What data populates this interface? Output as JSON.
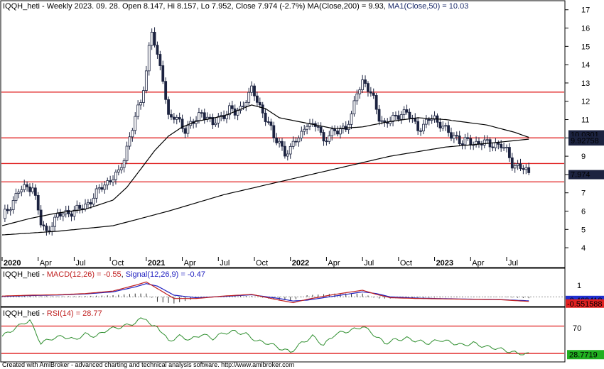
{
  "panels": {
    "price": {
      "header_symbol": "IQQH_heti",
      "header_info": " - Weekly 2023. 09. 28. Open 8.147, Hi 8.157, Lo 7.952, Close 7.974 (-2.7%)",
      "header_ma200": "MA(Close,200) = 9.93",
      "header_ma50": "MA1(Close,50) = 10.03",
      "badges": [
        "10.0301",
        "9.92758",
        "7.974"
      ]
    },
    "macd": {
      "header_symbol": "IQQH_heti - ",
      "header_macd": "MACD(12,26) = -0.55",
      "header_signal": "Signal(12,26,9) = -0.47",
      "badges": [
        "-0.469418",
        "-0.551588"
      ],
      "axis_label": "1"
    },
    "rsi": {
      "header_symbol": "IQQH_heti - ",
      "header_rsi": "RSI(14) = 28.77",
      "badges": [
        "28.7719"
      ],
      "axis_label": "70"
    }
  },
  "footer": "Created with AmiBroker - advanced charting and technical analysis software. http://www.amibroker.com",
  "colors": {
    "up": "#ffffff",
    "down": "#1c2340",
    "hline": "#e02020",
    "ma": "#000000",
    "macd": "#2020c0",
    "signal": "#c02020",
    "rsi": "#2f8f2f",
    "badge_dark": "#1c2340",
    "badge_red": "#e02020",
    "badge_blue": "#2030d0",
    "badge_green": "#20b020"
  },
  "chart_data": [
    {
      "type": "candlestick",
      "title": "IQQH_heti - Weekly",
      "ylim": [
        3.5,
        17.3
      ],
      "yticks": [
        4,
        5,
        6,
        7,
        8,
        9,
        10,
        11,
        12,
        13,
        14,
        15,
        16,
        17
      ],
      "x_labels": [
        "2020",
        "Apr",
        "Jul",
        "Oct",
        "2021",
        "Apr",
        "Jul",
        "Oct",
        "2022",
        "Apr",
        "Jul",
        "Oct",
        "2023",
        "Apr",
        "Jul"
      ],
      "x_label_week": [
        0,
        13,
        26,
        39,
        52,
        65,
        78,
        91,
        104,
        117,
        130,
        143,
        156,
        169,
        182
      ],
      "horizontal_lines": [
        12.5,
        10.0,
        8.6,
        7.6
      ],
      "close_path_weeks": [
        0,
        6,
        11,
        14,
        16,
        18,
        20,
        23,
        25,
        28,
        30,
        33,
        36,
        38,
        40,
        42,
        44,
        45,
        46,
        48,
        50,
        52,
        53,
        54,
        56,
        58,
        60,
        62,
        64,
        66,
        68,
        70,
        72,
        74,
        76,
        78,
        80,
        82,
        84,
        86,
        88,
        90,
        92,
        94,
        96,
        98,
        100,
        102,
        104,
        106,
        108,
        110,
        112,
        114,
        116,
        118,
        120,
        122,
        124,
        126,
        128,
        130,
        131,
        132,
        134,
        136,
        138,
        140,
        142,
        144,
        146,
        148,
        150,
        152,
        154,
        156,
        158,
        160,
        162,
        164,
        166,
        168,
        170,
        172,
        174,
        176,
        178,
        180,
        182,
        184,
        186,
        188,
        190
      ],
      "close_path_values": [
        5.6,
        7.1,
        7.4,
        5.3,
        4.8,
        5.4,
        5.7,
        5.9,
        6.0,
        6.1,
        6.3,
        6.8,
        7.3,
        7.6,
        7.9,
        8.0,
        8.9,
        9.5,
        10.1,
        11.1,
        11.9,
        13.7,
        15.0,
        15.9,
        14.3,
        13.3,
        11.2,
        11.1,
        10.8,
        10.5,
        10.8,
        10.9,
        11.4,
        11.2,
        10.7,
        11.0,
        11.3,
        11.6,
        11.3,
        11.6,
        12.2,
        12.6,
        12.0,
        11.4,
        10.9,
        9.9,
        9.8,
        9.2,
        9.3,
        9.9,
        10.3,
        10.8,
        10.5,
        10.8,
        9.8,
        10.1,
        10.3,
        10.6,
        10.5,
        11.1,
        12.6,
        13.1,
        12.9,
        12.6,
        12.1,
        11.2,
        10.7,
        10.9,
        11.2,
        11.4,
        11.3,
        11.0,
        10.6,
        10.6,
        11.0,
        11.1,
        10.8,
        10.4,
        10.1,
        10.1,
        9.7,
        9.8,
        9.7,
        9.8,
        9.7,
        9.6,
        9.7,
        9.6,
        9.2,
        8.6,
        8.5,
        8.3,
        7.97
      ],
      "ma50_weeks": [
        0,
        10,
        20,
        30,
        40,
        45,
        50,
        55,
        60,
        65,
        70,
        80,
        90,
        95,
        100,
        110,
        120,
        130,
        140,
        150,
        160,
        170,
        175,
        180,
        185,
        190
      ],
      "ma50_values": [
        5.2,
        5.6,
        5.9,
        6.1,
        6.6,
        7.3,
        8.3,
        9.3,
        10.1,
        10.6,
        10.9,
        11.2,
        11.8,
        11.6,
        11.1,
        10.8,
        10.5,
        10.6,
        10.9,
        11.1,
        11.0,
        10.8,
        10.7,
        10.5,
        10.3,
        10.03
      ],
      "ma200_weeks": [
        0,
        20,
        40,
        60,
        80,
        100,
        120,
        140,
        160,
        175,
        190
      ],
      "ma200_values": [
        4.7,
        4.9,
        5.2,
        6.0,
        6.9,
        7.6,
        8.3,
        9.0,
        9.5,
        9.7,
        9.93
      ],
      "last_close": 7.974
    },
    {
      "type": "line",
      "title": "MACD(12,26) / Signal(12,26,9)",
      "series": [
        {
          "name": "MACD(12,26)",
          "weeks": [
            0,
            10,
            20,
            30,
            40,
            48,
            52,
            56,
            62,
            70,
            80,
            90,
            100,
            105,
            110,
            120,
            130,
            135,
            140,
            150,
            160,
            170,
            180,
            190
          ],
          "values": [
            0.1,
            0.2,
            0.25,
            0.4,
            0.7,
            1.4,
            1.8,
            1.0,
            -0.2,
            -0.2,
            0.1,
            0.3,
            -0.4,
            -0.7,
            -0.3,
            0.3,
            0.8,
            0.3,
            -0.1,
            -0.2,
            -0.25,
            -0.3,
            -0.35,
            -0.55
          ]
        },
        {
          "name": "Signal(12,26,9)",
          "weeks": [
            0,
            10,
            20,
            30,
            40,
            48,
            52,
            56,
            62,
            70,
            80,
            90,
            100,
            105,
            110,
            120,
            130,
            135,
            140,
            150,
            160,
            170,
            180,
            190
          ],
          "values": [
            0.05,
            0.15,
            0.22,
            0.35,
            0.6,
            1.2,
            1.6,
            1.3,
            0.2,
            -0.1,
            0.05,
            0.25,
            -0.2,
            -0.5,
            -0.4,
            0.1,
            0.6,
            0.4,
            0.0,
            -0.15,
            -0.22,
            -0.28,
            -0.33,
            -0.47
          ]
        }
      ],
      "last_values": {
        "macd": -0.55,
        "signal": -0.47
      }
    },
    {
      "type": "line",
      "title": "RSI(14)",
      "ylim": [
        28,
        85
      ],
      "hlines": [
        70,
        30
      ],
      "series": [
        {
          "name": "RSI(14)",
          "weeks": [
            0,
            4,
            8,
            10,
            14,
            18,
            22,
            26,
            30,
            34,
            38,
            42,
            46,
            48,
            50,
            52,
            54,
            56,
            60,
            64,
            68,
            72,
            76,
            80,
            84,
            88,
            92,
            96,
            100,
            104,
            108,
            112,
            116,
            120,
            124,
            128,
            130,
            134,
            138,
            142,
            146,
            150,
            154,
            158,
            162,
            166,
            170,
            174,
            178,
            182,
            186,
            190
          ],
          "values": [
            55,
            65,
            75,
            78,
            45,
            52,
            55,
            50,
            58,
            55,
            65,
            68,
            72,
            75,
            80,
            82,
            68,
            70,
            48,
            55,
            50,
            58,
            52,
            60,
            62,
            58,
            48,
            45,
            38,
            32,
            45,
            55,
            42,
            58,
            62,
            66,
            70,
            58,
            45,
            50,
            52,
            48,
            45,
            50,
            46,
            42,
            45,
            40,
            38,
            34,
            30,
            28.77
          ]
        }
      ],
      "last_value": 28.77
    }
  ]
}
